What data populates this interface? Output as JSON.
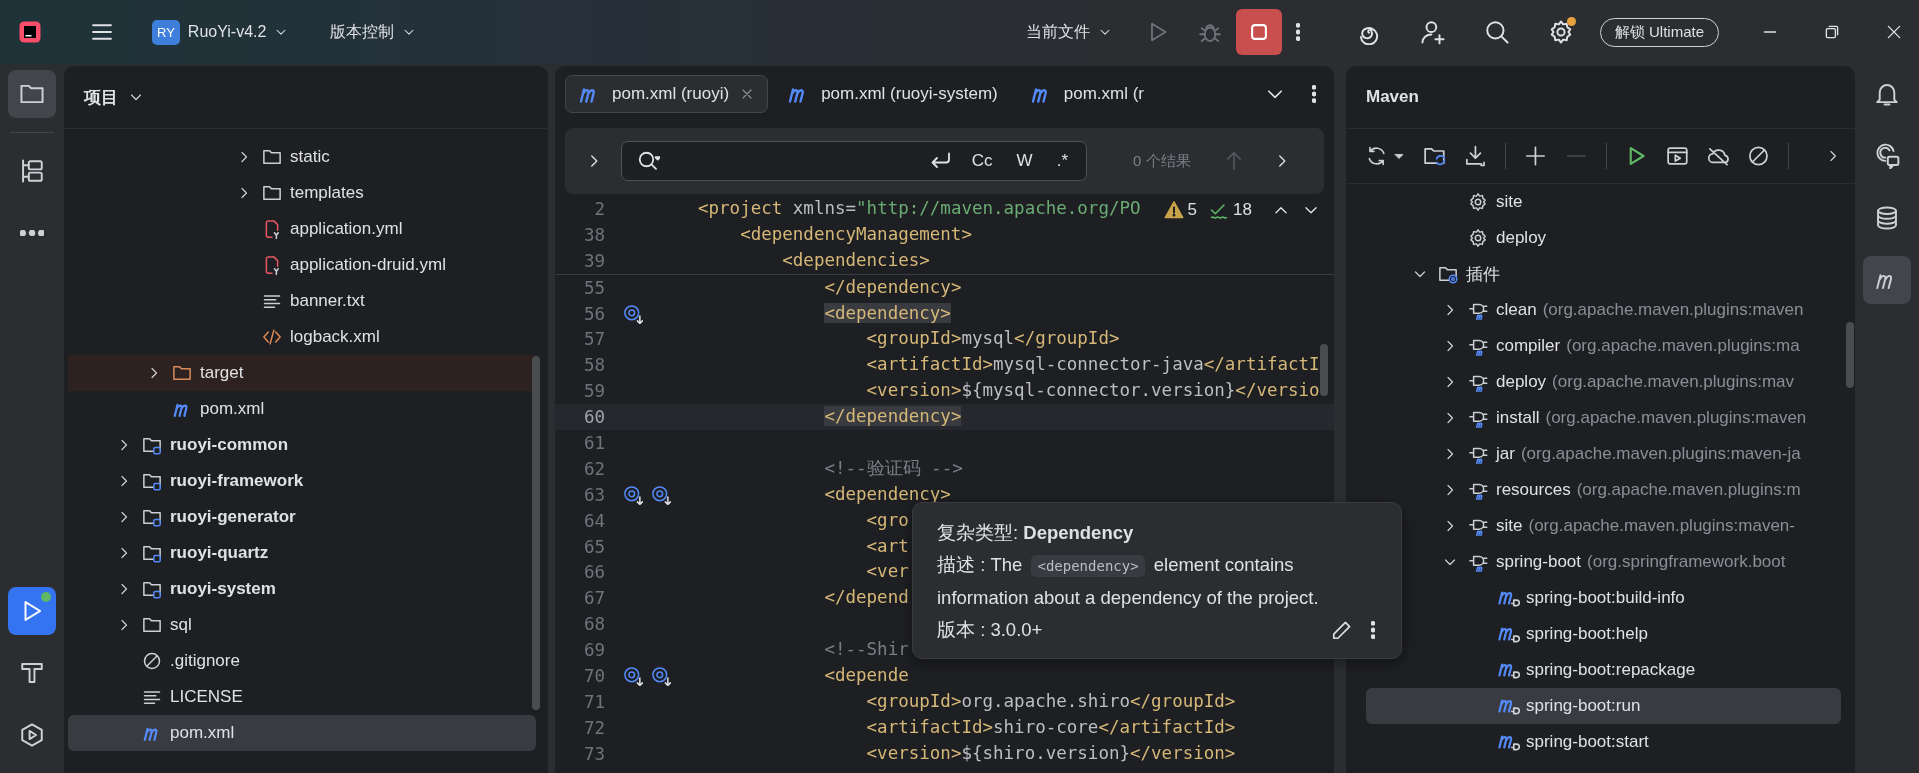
{
  "title_bar": {
    "project_badge": "RY",
    "project_name": "RuoYi-v4.2",
    "vcs_menu": "版本控制",
    "run_config": "当前文件",
    "upgrade_button": "解锁 Ultimate",
    "settings_update": true
  },
  "left_toolbar": [
    {
      "kind": "project",
      "selected": true,
      "running": false
    },
    {
      "kind": "structure",
      "selected": false,
      "running": false
    },
    {
      "kind": "more",
      "selected": false,
      "running": false
    },
    {
      "kind": "run",
      "selected": false,
      "running": true
    },
    {
      "kind": "build",
      "selected": false,
      "running": false
    },
    {
      "kind": "services",
      "selected": false,
      "running": false
    }
  ],
  "project_panel": {
    "title": "项目",
    "tree": [
      {
        "children": [
          {
            "children": [
              {
                "children": [
                  {
                    "children": [
                      {
                        "label": "static",
                        "kind": "folder",
                        "expanded": false,
                        "selected": false
                      },
                      {
                        "label": "templates",
                        "kind": "folder",
                        "expanded": false,
                        "selected": false
                      },
                      {
                        "label": "application.yml",
                        "kind": "yaml",
                        "selected": false
                      },
                      {
                        "label": "application-druid.yml",
                        "kind": "yaml",
                        "selected": false
                      },
                      {
                        "label": "banner.txt",
                        "kind": "text",
                        "selected": false
                      },
                      {
                        "label": "logback.xml",
                        "kind": "xml",
                        "selected": false
                      }
                    ]
                  }
                ]
              }
            ]
          },
          {
            "label": "target",
            "kind": "excluded",
            "expanded": false,
            "selected": false
          },
          {
            "label": "pom.xml",
            "kind": "maven",
            "selected": false
          }
        ]
      },
      {
        "label": "ruoyi-common",
        "kind": "module",
        "expanded": false,
        "selected": false
      },
      {
        "label": "ruoyi-framework",
        "kind": "module",
        "expanded": false,
        "selected": false
      },
      {
        "label": "ruoyi-generator",
        "kind": "module",
        "expanded": false,
        "selected": false
      },
      {
        "label": "ruoyi-quartz",
        "kind": "module",
        "expanded": false,
        "selected": false
      },
      {
        "label": "ruoyi-system",
        "kind": "module",
        "expanded": false,
        "selected": false
      },
      {
        "label": "sql",
        "kind": "folder",
        "expanded": false,
        "selected": false
      },
      {
        "label": ".gitignore",
        "kind": "ignore",
        "selected": false
      },
      {
        "label": "LICENSE",
        "kind": "text",
        "selected": false
      },
      {
        "label": "pom.xml",
        "kind": "maven",
        "selected": true
      }
    ]
  },
  "editor": {
    "tabs": [
      {
        "label": "pom.xml (ruoyi)",
        "selected": true
      },
      {
        "label": "pom.xml (ruoyi-system)",
        "selected": false
      },
      {
        "label": "pom.xml (r",
        "selected": false
      }
    ],
    "find": {
      "match_case": "Cc",
      "words": "W",
      "regex": ".*",
      "result": "0 个结果"
    },
    "inspections": {
      "warnings": "5",
      "passed": "18"
    },
    "sticky_lines": [
      {
        "number": "2",
        "text": "<project xmlns=\"http://maven.apache.org/PO"
      },
      {
        "number": "38",
        "text": "    <dependencyManagement>"
      },
      {
        "number": "39",
        "text": "        <dependencies>"
      }
    ],
    "lines": [
      {
        "number": "55",
        "text": "            </dependency>",
        "match": false,
        "current": false
      },
      {
        "number": "56",
        "text": "            <dependency>",
        "match": true,
        "current": false,
        "markers": [
          {
            "kind": "dependency"
          }
        ]
      },
      {
        "number": "57",
        "text": "                <groupId>mysql</groupId>",
        "match": false,
        "current": false
      },
      {
        "number": "58",
        "text": "                <artifactId>mysql-connector-java</artifactI",
        "match": false,
        "current": false
      },
      {
        "number": "59",
        "text": "                <version>${mysql-connector.version}</versio",
        "match": false,
        "current": false
      },
      {
        "number": "60",
        "text": "            </dependency>",
        "match": true,
        "current": true
      },
      {
        "number": "61",
        "current": false
      },
      {
        "number": "62",
        "text": "            <!--验证码 -->",
        "match": false,
        "current": false
      },
      {
        "number": "63",
        "text": "            <dependency>",
        "match": false,
        "current": false,
        "markers": [
          {
            "kind": "dependency"
          },
          {
            "kind": "dependency"
          }
        ]
      },
      {
        "number": "64",
        "text": "                <gro",
        "match": false,
        "current": false
      },
      {
        "number": "65",
        "text": "                <art",
        "match": false,
        "current": false
      },
      {
        "number": "66",
        "text": "                <ver",
        "match": false,
        "current": false
      },
      {
        "number": "67",
        "text": "            </depend",
        "match": false,
        "current": false
      },
      {
        "number": "68",
        "current": false
      },
      {
        "number": "69",
        "text": "            <!--Shir",
        "match": false,
        "current": false
      },
      {
        "number": "70",
        "text": "            <depende",
        "match": false,
        "current": false,
        "markers": [
          {
            "kind": "dependency"
          },
          {
            "kind": "dependency"
          }
        ]
      },
      {
        "number": "71",
        "text": "                <groupId>org.apache.shiro</groupId>",
        "match": false,
        "current": false
      },
      {
        "number": "72",
        "text": "                <artifactId>shiro-core</artifactId>",
        "match": false,
        "current": false
      },
      {
        "number": "73",
        "text": "                <version>${shiro.version}</version>",
        "match": false,
        "current": false
      }
    ]
  },
  "tooltip": {
    "title": "复杂类型: **Dependency**",
    "description_before": "描述 : The",
    "description_code": "<dependency>",
    "description_after": "element contains information about a dependency of the project.",
    "version": "版本 : 3.0.0+"
  },
  "maven_panel": {
    "title": "Maven",
    "tree": [
      {
        "children": [
          {
            "label": "site",
            "kind": "phase",
            "selected": false
          },
          {
            "label": "deploy",
            "kind": "phase",
            "selected": false
          }
        ]
      },
      {
        "label": "插件",
        "kind": "plugins",
        "expanded": true,
        "selected": false,
        "children": [
          {
            "label": "clean",
            "detail": "(org.apache.maven.plugins:maven",
            "kind": "plugin",
            "expanded": false,
            "selected": false
          },
          {
            "label": "compiler",
            "detail": "(org.apache.maven.plugins:ma",
            "kind": "plugin",
            "expanded": false,
            "selected": false
          },
          {
            "label": "deploy",
            "detail": "(org.apache.maven.plugins:mav",
            "kind": "plugin",
            "expanded": false,
            "selected": false
          },
          {
            "label": "install",
            "detail": "(org.apache.maven.plugins:maven",
            "kind": "plugin",
            "expanded": false,
            "selected": false
          },
          {
            "label": "jar",
            "detail": "(org.apache.maven.plugins:maven-ja",
            "kind": "plugin",
            "expanded": false,
            "selected": false
          },
          {
            "label": "resources",
            "detail": "(org.apache.maven.plugins:m",
            "kind": "plugin",
            "expanded": false,
            "selected": false
          },
          {
            "label": "site",
            "detail": "(org.apache.maven.plugins:maven-",
            "kind": "plugin",
            "expanded": false,
            "selected": false
          },
          {
            "label": "spring-boot",
            "detail": "(org.springframework.boot",
            "kind": "plugin",
            "expanded": true,
            "selected": false,
            "children": [
              {
                "label": "spring-boot:build-info",
                "kind": "goal",
                "selected": false
              },
              {
                "label": "spring-boot:help",
                "kind": "goal",
                "selected": false
              },
              {
                "label": "spring-boot:repackage",
                "kind": "goal",
                "selected": false
              },
              {
                "label": "spring-boot:run",
                "kind": "goal",
                "selected": true
              },
              {
                "label": "spring-boot:start",
                "kind": "goal",
                "selected": false
              }
            ]
          }
        ]
      }
    ]
  },
  "right_toolbar": [
    {
      "kind": "notifications",
      "selected": false
    },
    {
      "kind": "ai-chat",
      "selected": false
    },
    {
      "kind": "database",
      "selected": false
    },
    {
      "kind": "maven",
      "selected": true
    }
  ]
}
